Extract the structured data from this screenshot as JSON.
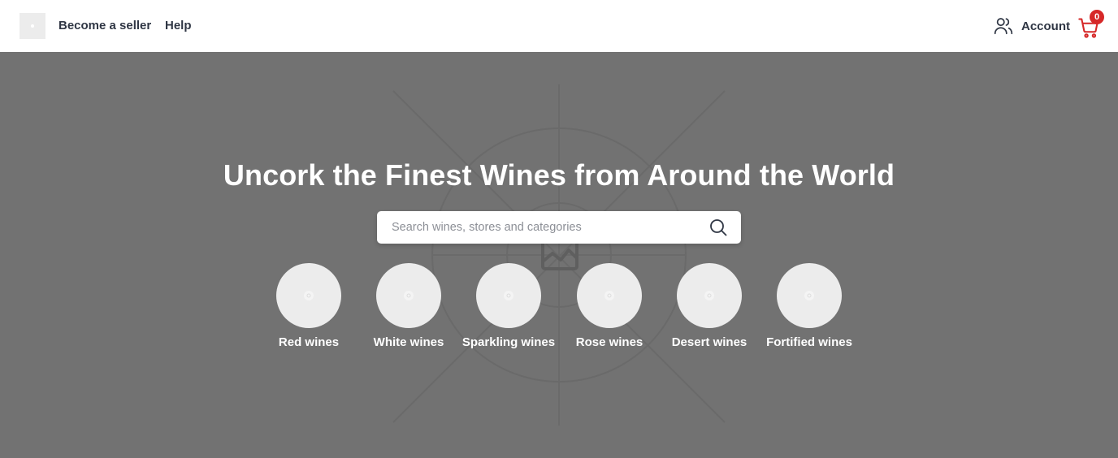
{
  "header": {
    "nav": {
      "become_seller": "Become a seller",
      "help": "Help"
    },
    "account_label": "Account",
    "cart_count": "0",
    "colors": {
      "text": "#2f3644",
      "badge": "#d62828"
    }
  },
  "hero": {
    "title": "Uncork the Finest Wines from Around the World",
    "search": {
      "placeholder": "Search wines, stores and categories",
      "value": ""
    },
    "categories": [
      {
        "label": "Red wines",
        "icon": "image-placeholder-icon"
      },
      {
        "label": "White wines",
        "icon": "image-placeholder-icon"
      },
      {
        "label": "Sparkling wines",
        "icon": "image-placeholder-icon"
      },
      {
        "label": "Rose wines",
        "icon": "image-placeholder-icon"
      },
      {
        "label": "Desert wines",
        "icon": "image-placeholder-icon"
      },
      {
        "label": "Fortified wines",
        "icon": "image-placeholder-icon"
      }
    ],
    "colors": {
      "background": "#727272",
      "category_circle": "#ececec"
    }
  }
}
